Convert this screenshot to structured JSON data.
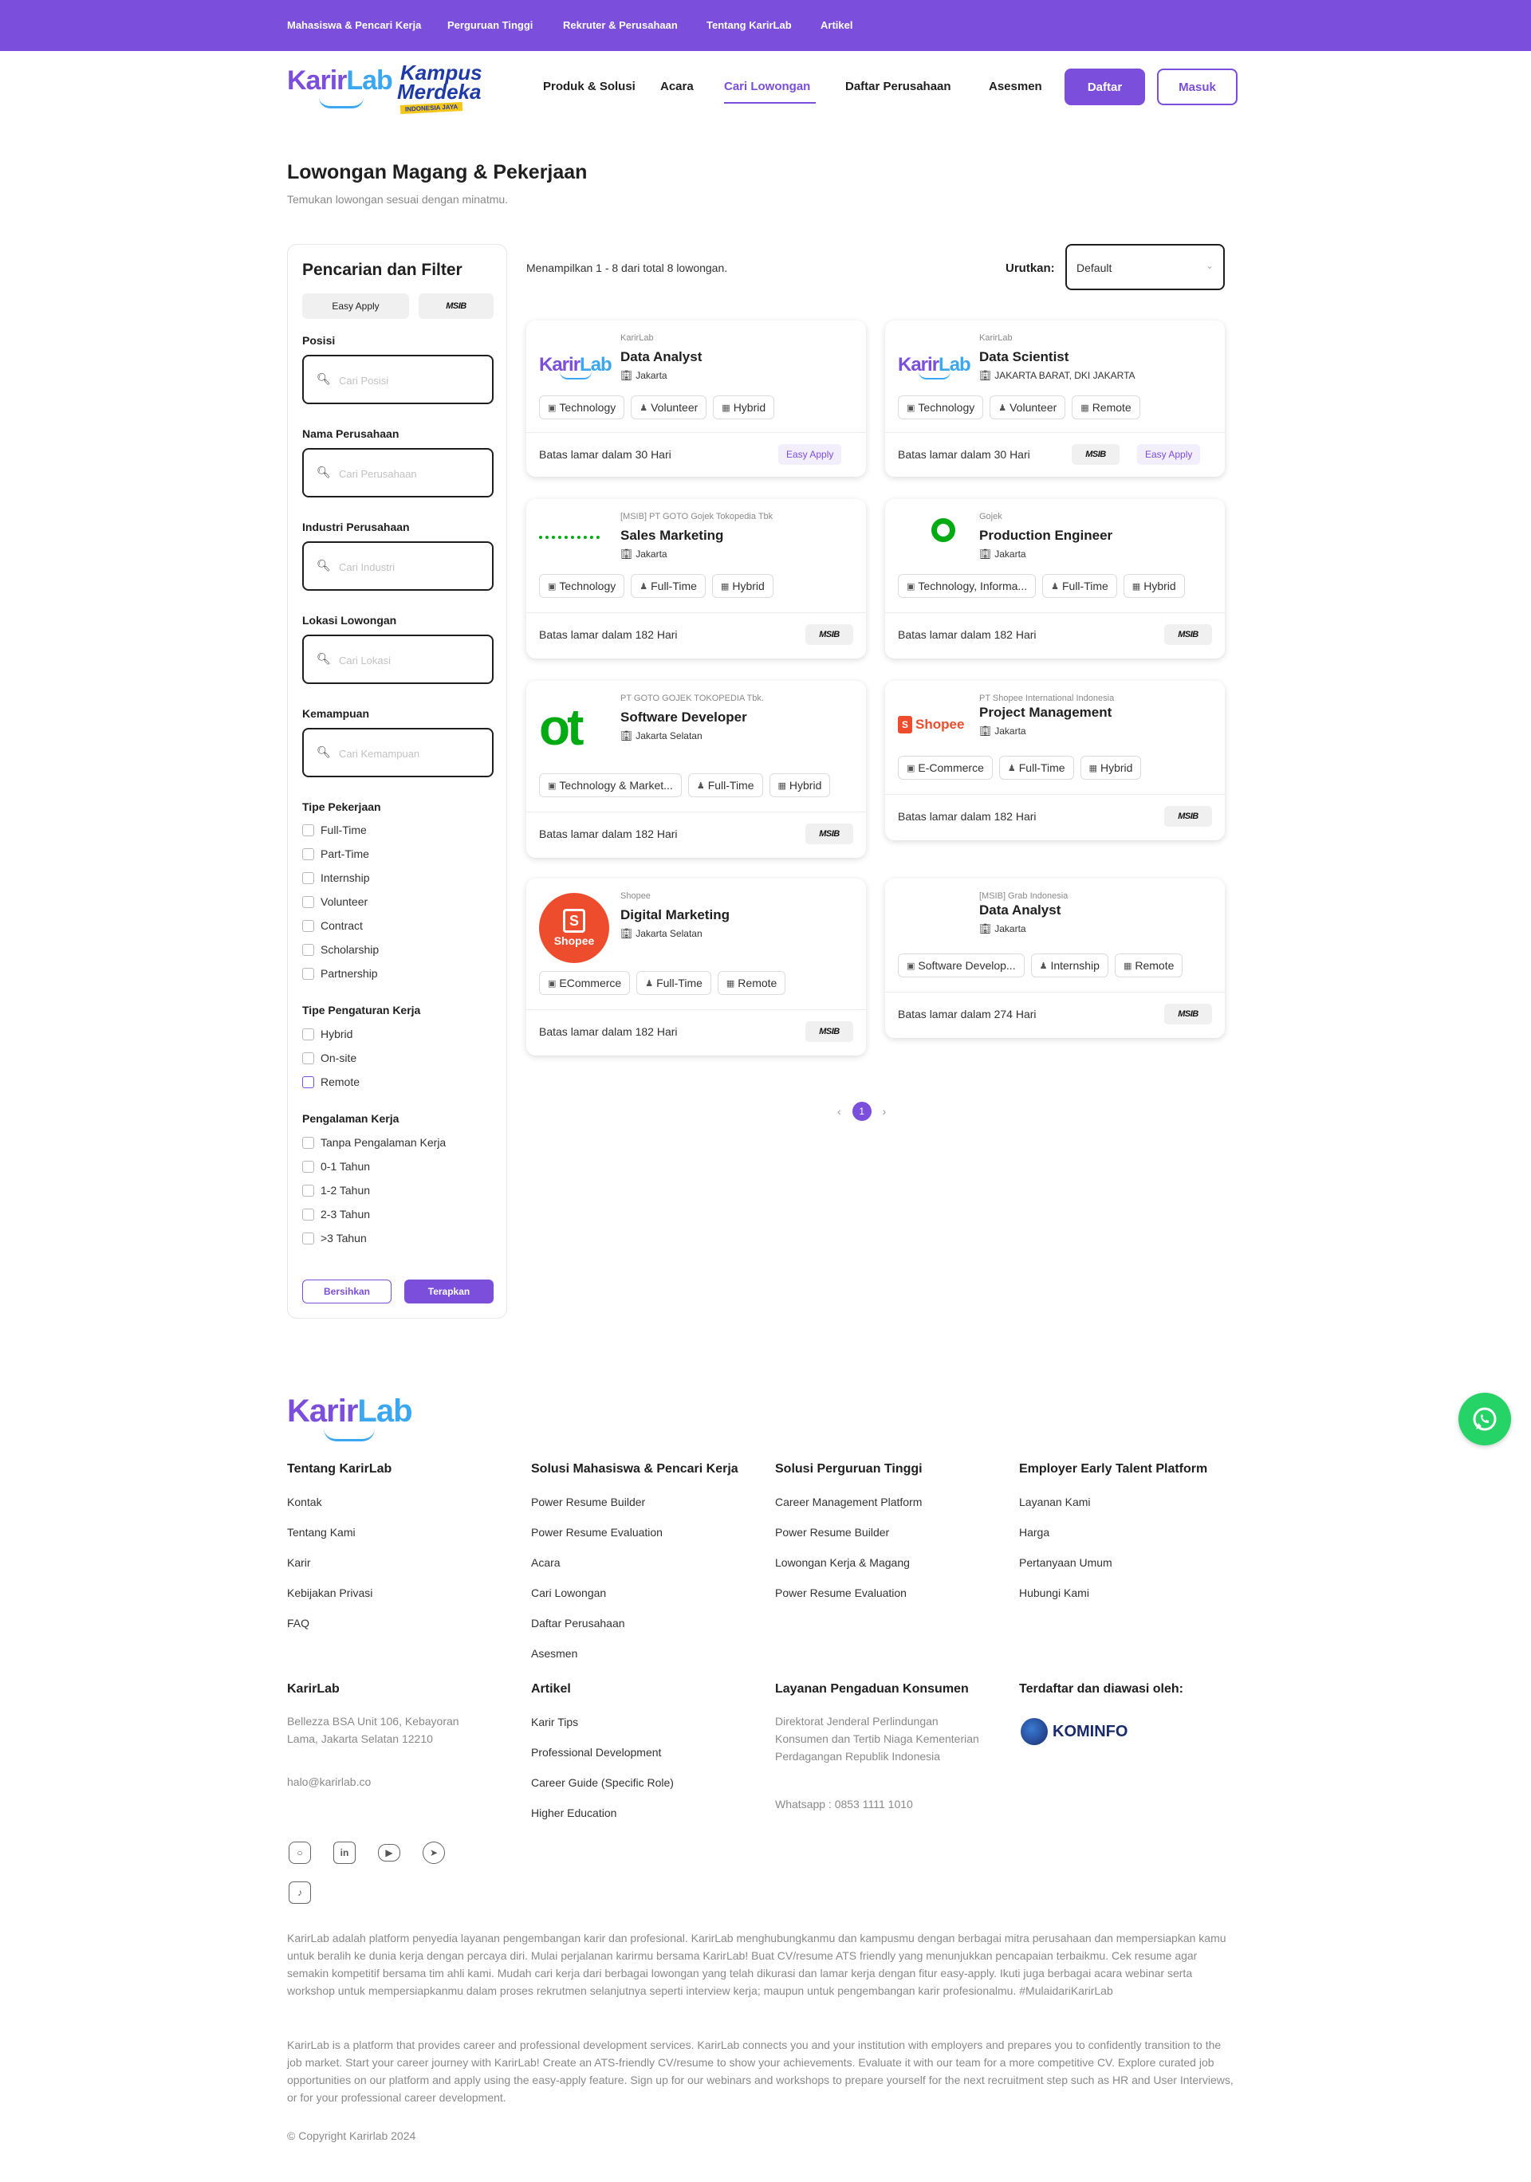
{
  "topbar": {
    "links": [
      "Mahasiswa & Pencari Kerja",
      "Perguruan Tinggi",
      "Rekruter & Perusahaan",
      "Tentang KarirLab",
      "Artikel"
    ]
  },
  "header": {
    "logo_left": "Karir",
    "logo_right": "Lab",
    "kampus_l1": "Kampus",
    "kampus_l2": "Merdeka",
    "kampus_l3": "INDONESIA JAYA",
    "nav": [
      "Produk & Solusi",
      "Acara",
      "Cari Lowongan",
      "Daftar Perusahaan",
      "Asesmen"
    ],
    "active_nav": "Cari Lowongan",
    "btn_daftar": "Daftar",
    "btn_masuk": "Masuk"
  },
  "page": {
    "title": "Lowongan Magang & Pekerjaan",
    "subtitle": "Temukan lowongan sesuai dengan minatmu."
  },
  "filter": {
    "title": "Pencarian dan Filter",
    "chip_easy": "Easy Apply",
    "chip_msib": "MSIB",
    "fields": [
      {
        "label": "Posisi",
        "placeholder": "Cari Posisi"
      },
      {
        "label": "Nama Perusahaan",
        "placeholder": "Cari Perusahaan"
      },
      {
        "label": "Industri Perusahaan",
        "placeholder": "Cari Industri"
      },
      {
        "label": "Lokasi Lowongan",
        "placeholder": "Cari Lokasi"
      },
      {
        "label": "Kemampuan",
        "placeholder": "Cari Kemampuan"
      }
    ],
    "tipe_pekerjaan": {
      "label": "Tipe Pekerjaan",
      "options": [
        "Full-Time",
        "Part-Time",
        "Internship",
        "Volunteer",
        "Contract",
        "Scholarship",
        "Partnership"
      ]
    },
    "tipe_pengaturan": {
      "label": "Tipe Pengaturan Kerja",
      "options": [
        "Hybrid",
        "On-site",
        "Remote"
      ]
    },
    "pengalaman": {
      "label": "Pengalaman Kerja",
      "options": [
        "Tanpa Pengalaman Kerja",
        "0-1 Tahun",
        "1-2 Tahun",
        "2-3 Tahun",
        ">3 Tahun"
      ]
    },
    "btn_clear": "Bersihkan",
    "btn_apply": "Terapkan"
  },
  "results": {
    "count_text": "Menampilkan 1 - 8 dari total 8 lowongan.",
    "sort_label": "Urutkan:",
    "sort_value": "Default",
    "pagination_current": "1"
  },
  "jobs": [
    {
      "company": "KarirLab",
      "title": "Data Analyst",
      "location": "Jakarta",
      "tags": [
        "Technology",
        "Volunteer",
        "Hybrid"
      ],
      "deadline": "Batas lamar dalam 30 Hari",
      "easy_apply": "Easy Apply",
      "logo": "karirlab"
    },
    {
      "company": "KarirLab",
      "title": "Data Scientist",
      "location": "JAKARTA BARAT, DKI JAKARTA",
      "tags": [
        "Technology",
        "Volunteer",
        "Remote"
      ],
      "deadline": "Batas lamar dalam 30 Hari",
      "easy_apply": "Easy Apply",
      "msib": "MSIB",
      "logo": "karirlab"
    },
    {
      "company": "[MSIB] PT GOTO Gojek Tokopedia Tbk",
      "title": "Sales Marketing",
      "location": "Jakarta",
      "tags": [
        "Technology",
        "Full-Time",
        "Hybrid"
      ],
      "deadline": "Batas lamar dalam 182 Hari",
      "msib": "MSIB",
      "logo": "goto-small"
    },
    {
      "company": "Gojek",
      "title": "Production Engineer",
      "location": "Jakarta",
      "tags": [
        "Technology, Informa...",
        "Full-Time",
        "Hybrid"
      ],
      "deadline": "Batas lamar dalam 182 Hari",
      "msib": "MSIB",
      "logo": "gojek"
    },
    {
      "company": "PT GOTO GOJEK TOKOPEDIA Tbk.",
      "title": "Software Developer",
      "location": "Jakarta Selatan",
      "tags": [
        "Technology & Market...",
        "Full-Time",
        "Hybrid"
      ],
      "deadline": "Batas lamar dalam 182 Hari",
      "msib": "MSIB",
      "logo": "goto"
    },
    {
      "company": "PT Shopee International Indonesia",
      "title": "Project Management",
      "location": "Jakarta",
      "tags": [
        "E-Commerce",
        "Full-Time",
        "Hybrid"
      ],
      "deadline": "Batas lamar dalam 182 Hari",
      "msib": "MSIB",
      "logo": "shopee-text",
      "logo_text": "Shopee"
    },
    {
      "company": "Shopee",
      "title": "Digital Marketing",
      "location": "Jakarta Selatan",
      "tags": [
        "ECommerce",
        "Full-Time",
        "Remote"
      ],
      "deadline": "Batas lamar dalam 182 Hari",
      "msib": "MSIB",
      "logo": "shopee-circle",
      "logo_text": "Shopee"
    },
    {
      "company": "[MSIB] Grab Indonesia",
      "title": "Data Analyst",
      "location": "Jakarta",
      "tags": [
        "Software Develop...",
        "Internship",
        "Remote"
      ],
      "deadline": "Batas lamar dalam 274 Hari",
      "msib": "MSIB",
      "logo": "none"
    }
  ],
  "footer": {
    "logo_left": "Karir",
    "logo_right": "Lab",
    "col1": {
      "head": "Tentang KarirLab",
      "links": [
        "Kontak",
        "Tentang Kami",
        "Karir",
        "Kebijakan Privasi",
        "FAQ"
      ]
    },
    "col2": {
      "head": "Solusi Mahasiswa & Pencari Kerja",
      "links": [
        "Power Resume Builder",
        "Power Resume Evaluation",
        "Acara",
        "Cari Lowongan",
        "Daftar Perusahaan",
        "Asesmen"
      ]
    },
    "col3": {
      "head": "Solusi Perguruan Tinggi",
      "links": [
        "Career Management Platform",
        "Power Resume Builder",
        "Lowongan Kerja & Magang",
        "Power Resume Evaluation"
      ]
    },
    "col4": {
      "head": "Employer Early Talent Platform",
      "links": [
        "Layanan Kami",
        "Harga",
        "Pertanyaan Umum",
        "Hubungi Kami"
      ]
    },
    "karirlab": {
      "head": "KarirLab",
      "address": "Bellezza BSA Unit 106, Kebayoran Lama, Jakarta Selatan 12210",
      "email": "halo@karirlab.co"
    },
    "artikel": {
      "head": "Artikel",
      "links": [
        "Karir Tips",
        "Professional Development",
        "Career Guide (Specific Role)",
        "Higher Education"
      ]
    },
    "pengaduan": {
      "head": "Layanan Pengaduan Konsumen",
      "text": "Direktorat Jenderal Perlindungan Konsumen dan Tertib Niaga Kementerian Perdagangan Republik Indonesia",
      "whatsapp": "Whatsapp : 0853 1111 1010"
    },
    "terdaftar": {
      "head": "Terdaftar dan diawasi oleh:",
      "kominfo": "KOMINFO"
    },
    "social": [
      "instagram-icon",
      "linkedin-icon",
      "youtube-icon",
      "telegram-icon",
      "tiktok-icon"
    ],
    "para_id": "KarirLab adalah platform penyedia layanan pengembangan karir dan profesional. KarirLab menghubungkanmu dan kampusmu dengan berbagai mitra perusahaan dan mempersiapkan kamu untuk beralih ke dunia kerja dengan percaya diri. Mulai perjalanan karirmu bersama KarirLab! Buat CV/resume ATS friendly yang menunjukkan pencapaian terbaikmu. Cek resume agar semakin kompetitif bersama tim ahli kami. Mudah cari kerja dari berbagai lowongan yang telah dikurasi dan lamar kerja dengan fitur easy-apply. Ikuti juga berbagai acara webinar serta workshop untuk mempersiapkanmu dalam proses rekrutmen selanjutnya seperti interview kerja; maupun untuk pengembangan karir profesionalmu. #MulaidariKarirLab",
    "para_en": "KarirLab is a platform that provides career and professional development services. KarirLab connects you and your institution with employers and prepares you to confidently transition to the job market. Start your career journey with KarirLab! Create an ATS-friendly CV/resume to show your achievements. Evaluate it with our team for a more competitive CV. Explore curated job opportunities on our platform and apply using the easy-apply feature. Sign up for our webinars and workshops to prepare yourself for the next recruitment step such as HR and User Interviews, or for your professional career development.",
    "copyright": "© Copyright Karirlab 2024"
  },
  "colors": {
    "primary": "#7B4EDB",
    "accent_blue": "#3BA7F0",
    "whatsapp": "#25D366"
  }
}
